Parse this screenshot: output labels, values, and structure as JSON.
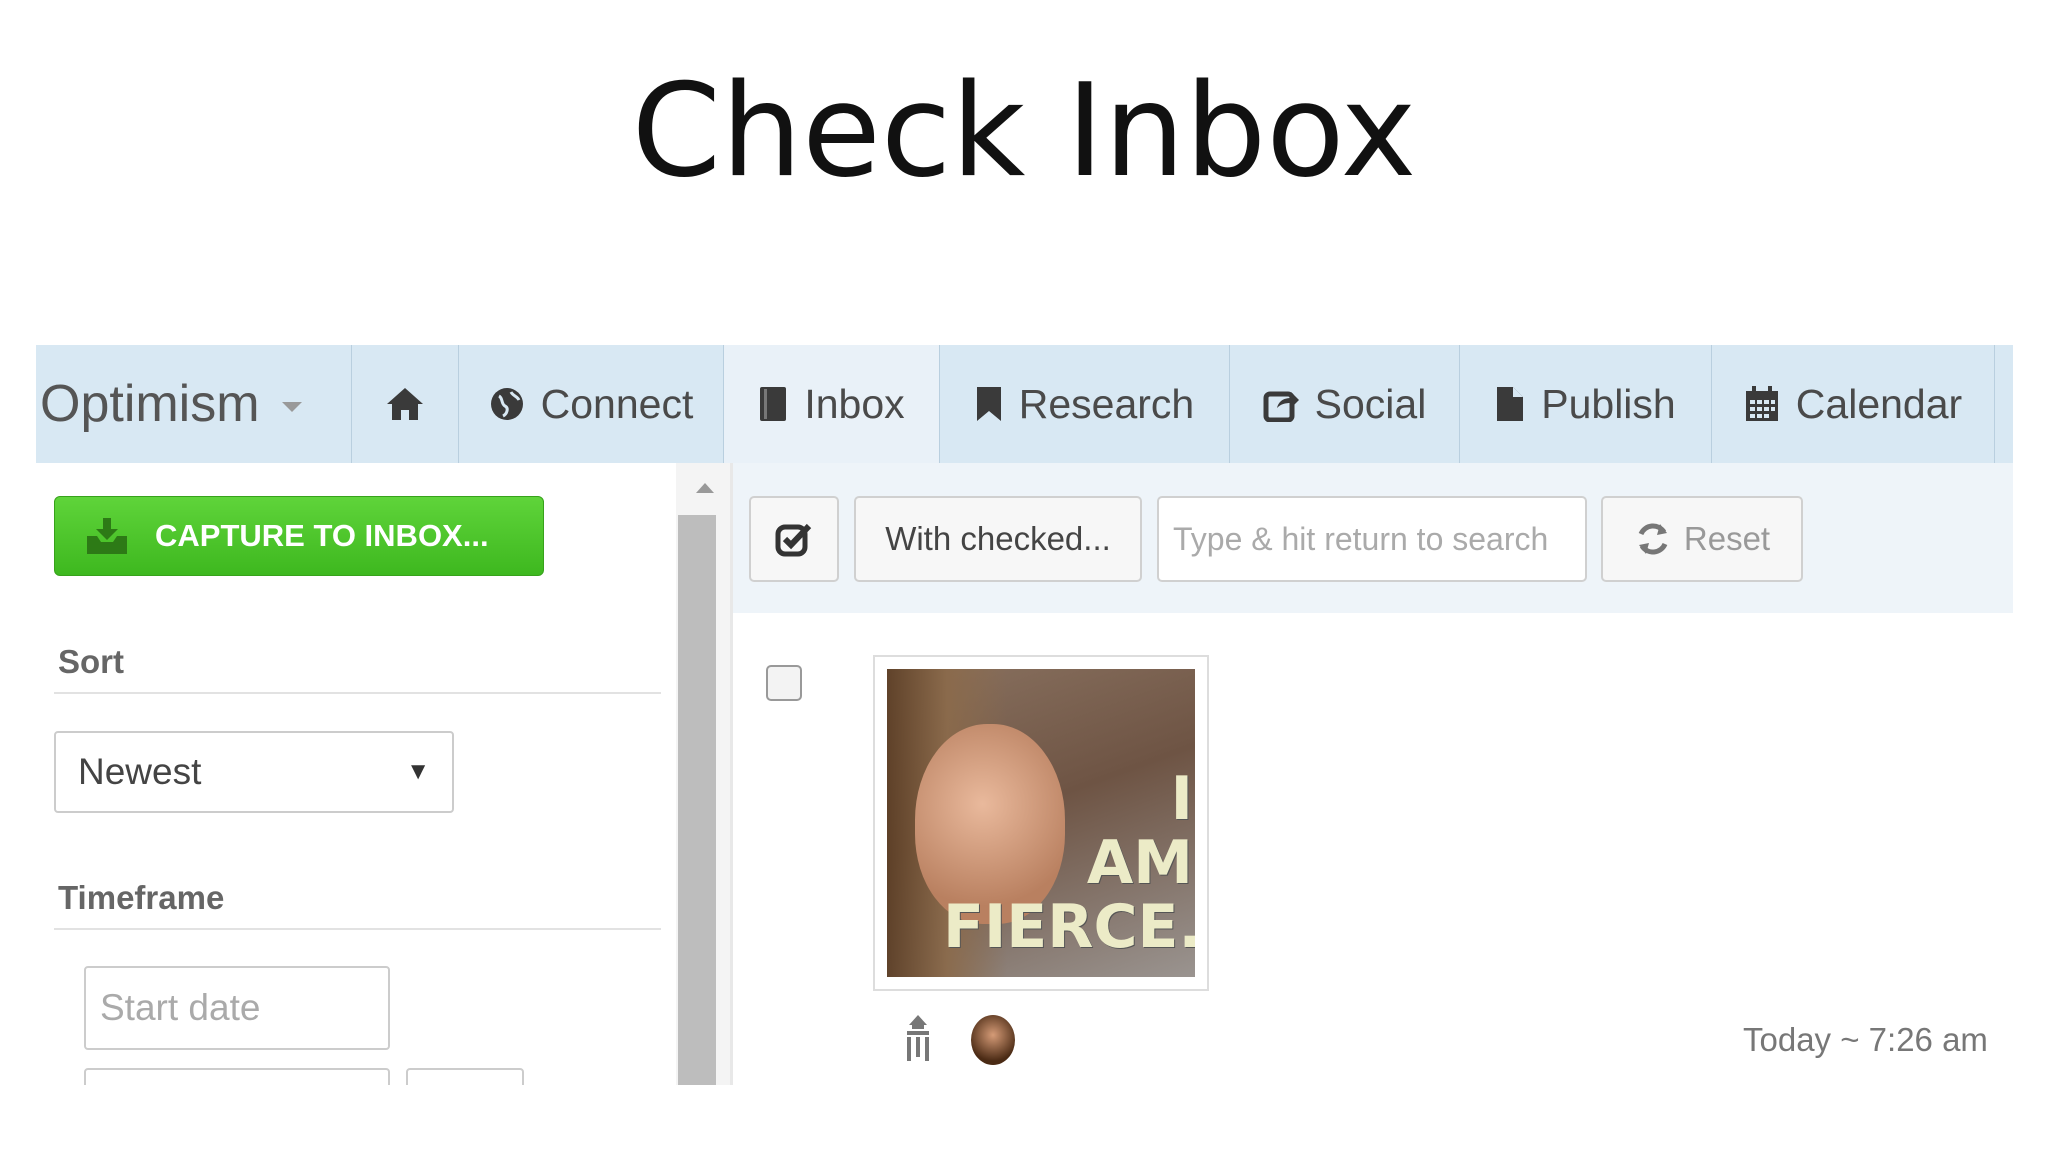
{
  "slide": {
    "title": "Check Inbox"
  },
  "nav": {
    "brand": "Optimism",
    "items": [
      {
        "label": "Connect",
        "icon": "globe-icon"
      },
      {
        "label": "Inbox",
        "icon": "book-icon",
        "active": true
      },
      {
        "label": "Research",
        "icon": "bookmark-icon"
      },
      {
        "label": "Social",
        "icon": "share-icon"
      },
      {
        "label": "Publish",
        "icon": "file-icon"
      },
      {
        "label": "Calendar",
        "icon": "calendar-icon"
      }
    ],
    "home_icon": "home-icon"
  },
  "sidebar": {
    "capture_label": "CAPTURE TO INBOX...",
    "sort_label": "Sort",
    "sort_value": "Newest",
    "timeframe_label": "Timeframe",
    "start_date_placeholder": "Start date"
  },
  "toolbar": {
    "with_checked_label": "With checked...",
    "search_placeholder": "Type & hit return to search",
    "reset_label": "Reset"
  },
  "item": {
    "image_text": "I AM FIERCE.",
    "timestamp": "Today ~ 7:26 am"
  },
  "colors": {
    "navbar": "#d8e8f3",
    "capture_button": "#4cc52a",
    "toolbar": "#eef4f9"
  }
}
